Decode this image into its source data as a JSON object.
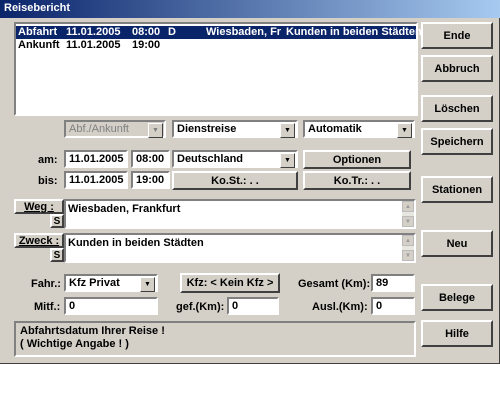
{
  "window": {
    "title": "Reisebericht"
  },
  "list": {
    "rows": [
      {
        "type": "Abfahrt",
        "date": "11.01.2005",
        "time": "08:00",
        "flag": "D",
        "place": "Wiesbaden, Fr",
        "purpose": "Kunden in beiden Städten",
        "selected": true
      },
      {
        "type": "Ankunft",
        "date": "11.01.2005",
        "time": "19:00",
        "flag": "",
        "place": "",
        "purpose": "",
        "selected": false
      }
    ]
  },
  "side_buttons": {
    "ende": "Ende",
    "abbruch": "Abbruch",
    "loeschen": "Löschen",
    "speichern": "Speichern",
    "stationen": "Stationen",
    "neu": "Neu",
    "belege": "Belege",
    "hilfe": "Hilfe"
  },
  "combos": {
    "abf_ankunft": "Abf./Ankunft",
    "reiseart": "Dienstreise",
    "modus": "Automatik",
    "land": "Deutschland",
    "fahrzeug": "Kfz Privat"
  },
  "dates": {
    "am_label": "am:",
    "bis_label": "bis:",
    "am_date": "11.01.2005",
    "am_time": "08:00",
    "bis_date": "11.01.2005",
    "bis_time": "19:00"
  },
  "buttons": {
    "optionen": "Optionen",
    "kost": "Ko.St.:  .  .",
    "kotr": "Ko.Tr.:  .  .",
    "weg": "Weg :",
    "zweck": "Zweck :",
    "s": "S",
    "kfz": "Kfz: < Kein Kfz >"
  },
  "weg_text": "Wiesbaden, Frankfurt",
  "zweck_text": "Kunden in beiden Städten",
  "bottom": {
    "fahr_label": "Fahr.:",
    "mitf_label": "Mitf.:",
    "mitf_value": "0",
    "gesamt_label": "Gesamt (Km):",
    "gesamt_value": "89",
    "gef_label": "gef.(Km):",
    "gef_value": "0",
    "ausl_label": "Ausl.(Km):",
    "ausl_value": "0"
  },
  "status": {
    "line1": "Abfahrtsdatum Ihrer Reise !",
    "line2": "( Wichtige Angabe ! )"
  }
}
